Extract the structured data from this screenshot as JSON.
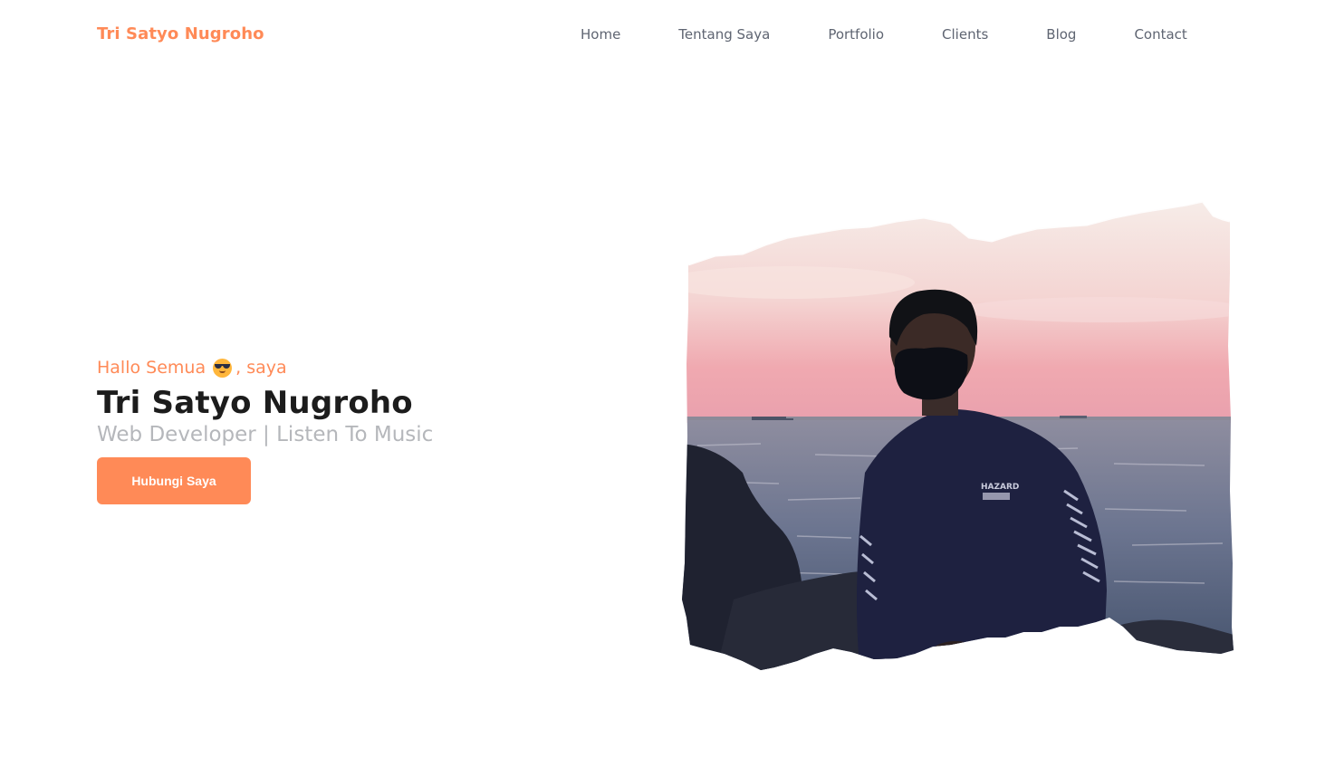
{
  "brand": {
    "name": "Tri Satyo Nugroho"
  },
  "nav": {
    "items": [
      {
        "label": "Home"
      },
      {
        "label": "Tentang Saya"
      },
      {
        "label": "Portfolio"
      },
      {
        "label": "Clients"
      },
      {
        "label": "Blog"
      },
      {
        "label": "Contact"
      }
    ]
  },
  "hero": {
    "greeting_prefix": "Hallo Semua",
    "greeting_emoji": "smiling-face-with-sunglasses-icon",
    "greeting_suffix": ", saya",
    "name": "Tri Satyo Nugroho",
    "tagline": "Web Developer | Listen To Music",
    "cta_label": "Hubungi Saya",
    "photo_shirt_text": "HAZARD"
  },
  "colors": {
    "accent": "#ff8a57",
    "nav_text": "#5f6572",
    "heading": "#1c1c1c",
    "muted": "#b5b7bb"
  }
}
